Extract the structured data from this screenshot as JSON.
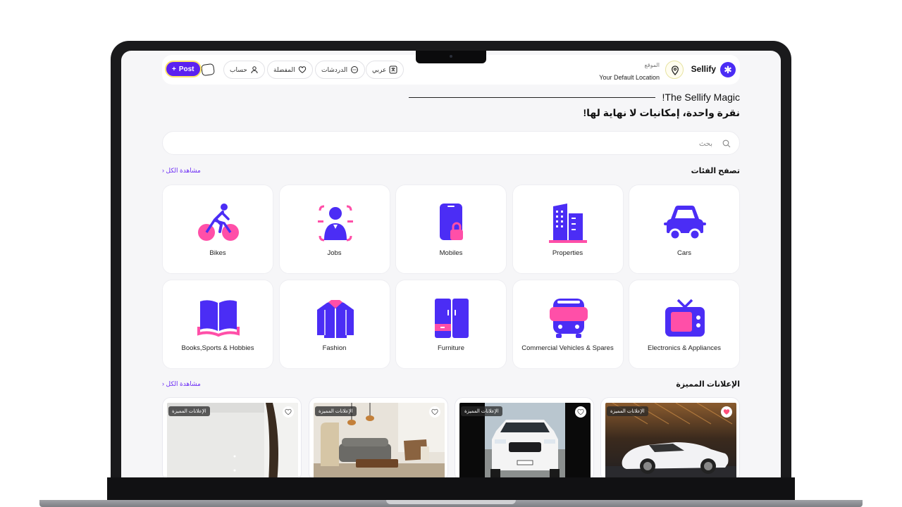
{
  "brand": {
    "name": "Sellify",
    "accent": "#4b2df5",
    "pink": "#ff4fa8"
  },
  "location": {
    "label": "الموقع",
    "value": "Your Default Location"
  },
  "nav": {
    "lang": "عربي",
    "chats": "الدردشات",
    "favorites": "المفضلة",
    "account": "حساب",
    "post": "Post"
  },
  "hero": {
    "title": "!The Sellify Magic",
    "subtitle": "نقرة واحدة، إمكانيات لا نهاية لها!"
  },
  "search": {
    "placeholder": "بحث"
  },
  "categories_section": {
    "title": "تصفح الفئات",
    "see_all": "مشاهدة الكل"
  },
  "categories": [
    {
      "label": "Cars",
      "icon": "car-icon"
    },
    {
      "label": "Properties",
      "icon": "building-icon"
    },
    {
      "label": "Mobiles",
      "icon": "mobile-lock-icon"
    },
    {
      "label": "Jobs",
      "icon": "person-icon"
    },
    {
      "label": "Bikes",
      "icon": "bicycle-icon"
    },
    {
      "label": "Electronics & Appliances",
      "icon": "tv-icon"
    },
    {
      "label": "Commercial Vehicles & Spares",
      "icon": "bus-icon"
    },
    {
      "label": "Furniture",
      "icon": "cupboard-icon"
    },
    {
      "label": "Fashion",
      "icon": "jacket-icon"
    },
    {
      "label": "Books,Sports & Hobbies",
      "icon": "book-icon"
    }
  ],
  "featured_section": {
    "title": "الإعلانات المميزة",
    "see_all": "مشاهدة الكل"
  },
  "featured_ads": [
    {
      "badge": "الإعلانات المميزة",
      "favorited": true
    },
    {
      "badge": "الإعلانات المميزة",
      "favorited": false
    },
    {
      "badge": "الإعلانات المميزة",
      "favorited": false
    },
    {
      "badge": "الإعلانات المميزة",
      "favorited": false
    }
  ]
}
